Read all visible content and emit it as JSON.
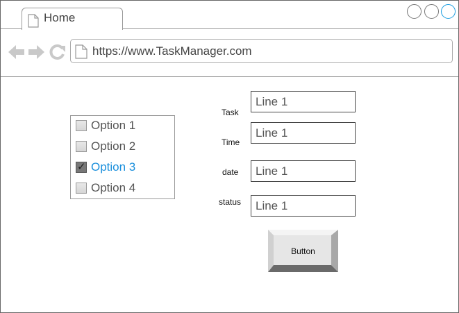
{
  "browser": {
    "tab_title": "Home",
    "url": "https://www.TaskManager.com",
    "icons": {
      "back": "back-arrow-icon",
      "forward": "forward-arrow-icon",
      "reload": "reload-icon",
      "page": "page-icon"
    },
    "accent_color": "#1a9de0"
  },
  "options": {
    "items": [
      {
        "label": "Option 1",
        "checked": false
      },
      {
        "label": "Option 2",
        "checked": false
      },
      {
        "label": "Option 3",
        "checked": true
      },
      {
        "label": "Option 4",
        "checked": false
      }
    ],
    "selected_color": "#1a8fdc"
  },
  "form": {
    "task_label": "Task",
    "task_value": "Line 1",
    "time_label": "Time",
    "time_value": "Line 1",
    "date_label": "date",
    "date_value": "Line 1",
    "status_label": "status",
    "status_value": "Line 1",
    "button_label": "Button"
  }
}
